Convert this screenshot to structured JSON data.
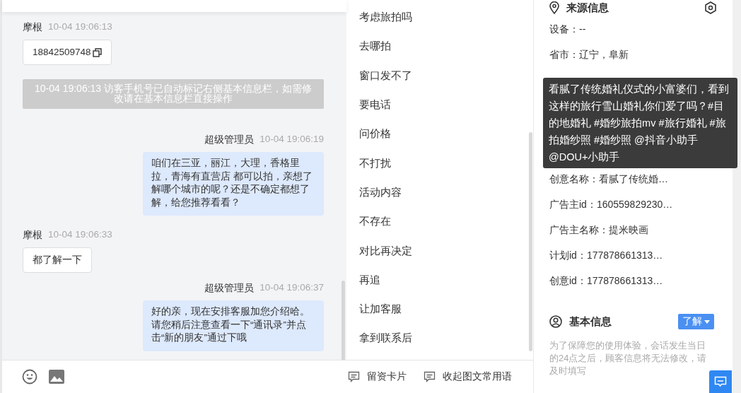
{
  "chat": {
    "messages": [
      {
        "kind": "visitor",
        "sender": "摩根",
        "time": "10-04 19:06:13",
        "text": "18842509748",
        "copyable": true
      },
      {
        "kind": "system",
        "text": "10-04 19:06:13 访客手机号已自动标记右侧基本信息栏，如需修改请在基本信息栏直接操作"
      },
      {
        "kind": "agent",
        "sender": "超级管理员",
        "time": "10-04 19:06:19",
        "text": "咱们在三亚，丽江，大理，香格里拉，青海有直营店 都可以拍，亲想了解哪个城市的呢？还是不确定都想了解，给您推荐看看？"
      },
      {
        "kind": "visitor",
        "sender": "摩根",
        "time": "10-04 19:06:33",
        "text": "都了解一下",
        "copyable": false
      },
      {
        "kind": "agent",
        "sender": "超级管理员",
        "time": "10-04 19:06:37",
        "text": "好的亲，现在安排客服加您介绍哈。请您稍后注意查看一下“通讯录”并点击“新的朋友”通过下哦"
      }
    ]
  },
  "phrases": {
    "items": [
      "考虑旅拍吗",
      "去哪拍",
      "窗口发不了",
      "要电话",
      "问价格",
      "不打扰",
      "活动内容",
      "不存在",
      "对比再决定",
      "再追",
      "让加客服",
      "拿到联系后"
    ],
    "footer": [
      "留资卡片",
      "收起图文常用语"
    ]
  },
  "source_info": {
    "title": "来源信息",
    "rows_above": [
      "设备：--",
      "省市：辽宁，阜新"
    ],
    "rows_below": [
      "创意名称：看腻了传统婚…",
      "广告主id：160559829230…",
      "广告主名称：提米映画",
      "计划id：177878661313…",
      "创意id：177878661313…"
    ],
    "tooltip": "看腻了传统婚礼仪式的小富婆们，看到这样的旅行雪山婚礼你们爱了吗？#目的地婚礼 #婚纱旅拍mv #旅行婚礼 #旅拍婚纱照 #婚纱照 @抖音小助手 @DOU+小助手"
  },
  "basic_info": {
    "title": "基本信息",
    "tag": "了解",
    "note": "为了保障您的使用体验，会话发生当日的24点之后，顾客信息将无法修改，请及时填写"
  }
}
